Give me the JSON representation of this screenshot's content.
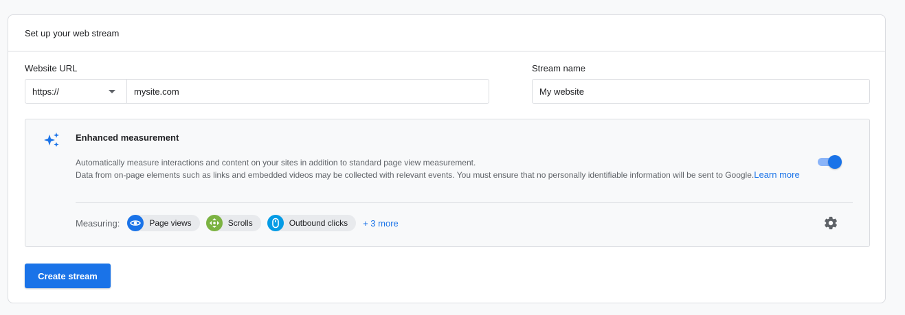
{
  "card": {
    "title": "Set up your web stream"
  },
  "website_url": {
    "label": "Website URL",
    "protocol": "https://",
    "value": "mysite.com"
  },
  "stream_name": {
    "label": "Stream name",
    "value": "My website"
  },
  "enhanced_measurement": {
    "title": "Enhanced measurement",
    "description_line1": "Automatically measure interactions and content on your sites in addition to standard page view measurement.",
    "description_line2": "Data from on-page elements such as links and embedded videos may be collected with relevant events. You must ensure that no personally identifiable information will be sent to Google.",
    "learn_more": "Learn more",
    "enabled": true,
    "measuring_label": "Measuring:",
    "chips": [
      {
        "label": "Page views",
        "icon": "eye-icon",
        "color": "#1a73e8"
      },
      {
        "label": "Scrolls",
        "icon": "scroll-icon",
        "color": "#7cb342"
      },
      {
        "label": "Outbound clicks",
        "icon": "mouse-icon",
        "color": "#039be5"
      }
    ],
    "more_link": "+ 3 more"
  },
  "actions": {
    "create_label": "Create stream"
  },
  "colors": {
    "accent": "#1a73e8",
    "border": "#dadce0",
    "panel_bg": "#f8f9fa"
  }
}
